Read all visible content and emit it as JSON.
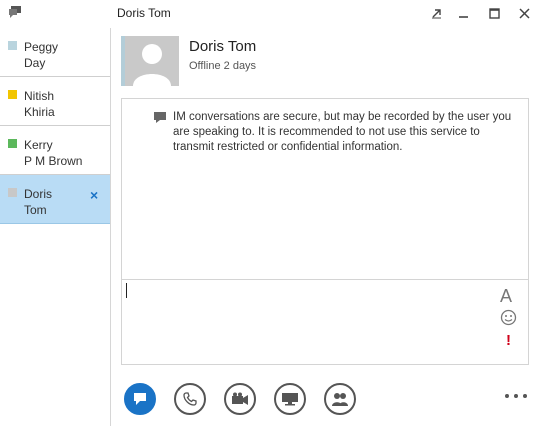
{
  "window": {
    "title": "Doris Tom"
  },
  "conversations": [
    {
      "name_line1": "Peggy",
      "name_line2": "Day",
      "status_color": "#b9d4de"
    },
    {
      "name_line1": "Nitish",
      "name_line2": "Khiria",
      "status_color": "#f2c500"
    },
    {
      "name_line1": "Kerry",
      "name_line2": "P M Brown",
      "status_color": "#5cb85c"
    },
    {
      "name_line1": "Doris",
      "name_line2": "Tom",
      "status_color": "#c8c8c8",
      "active": true,
      "close_label": "×"
    }
  ],
  "contact": {
    "name": "Doris Tom",
    "status": "Offline 2 days"
  },
  "conversation": {
    "notice": "IM conversations are secure, but may be recorded by the user you are speaking to.  It is recommended to not use this service to transmit restricted or confidential information."
  },
  "compose": {
    "font_glyph": "A",
    "importance_glyph": "!"
  },
  "actions": [
    {
      "icon": "im-icon"
    },
    {
      "icon": "phone-icon"
    },
    {
      "icon": "video-icon"
    },
    {
      "icon": "present-icon"
    },
    {
      "icon": "participants-icon"
    }
  ],
  "colors": {
    "accent": "#1a73c6",
    "active_conversation": "#b9dcf5",
    "importance": "#d0021b"
  }
}
